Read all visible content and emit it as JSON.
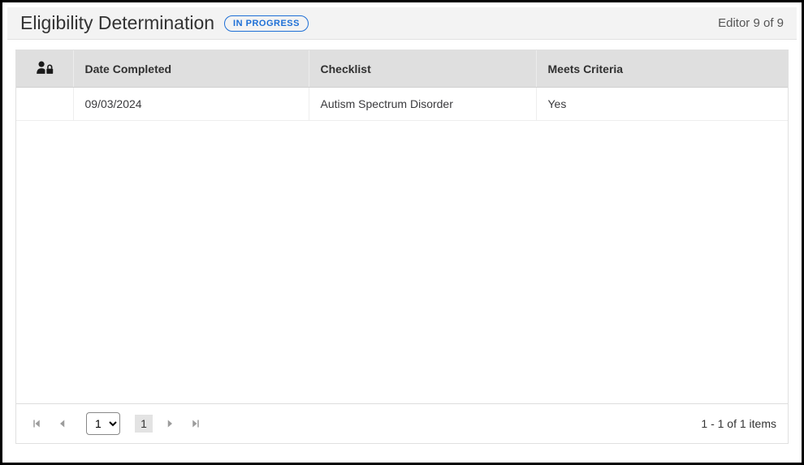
{
  "header": {
    "title": "Eligibility Determination",
    "status_label": "IN PROGRESS",
    "editor_counter": "Editor 9 of 9"
  },
  "table": {
    "columns": {
      "date_completed": "Date Completed",
      "checklist": "Checklist",
      "meets_criteria": "Meets Criteria"
    },
    "rows": [
      {
        "date_completed": "09/03/2024",
        "checklist": "Autism Spectrum Disorder",
        "meets_criteria": "Yes"
      }
    ]
  },
  "pager": {
    "page_select_value": "1",
    "current_page": "1",
    "summary": "1 - 1 of 1 items"
  }
}
